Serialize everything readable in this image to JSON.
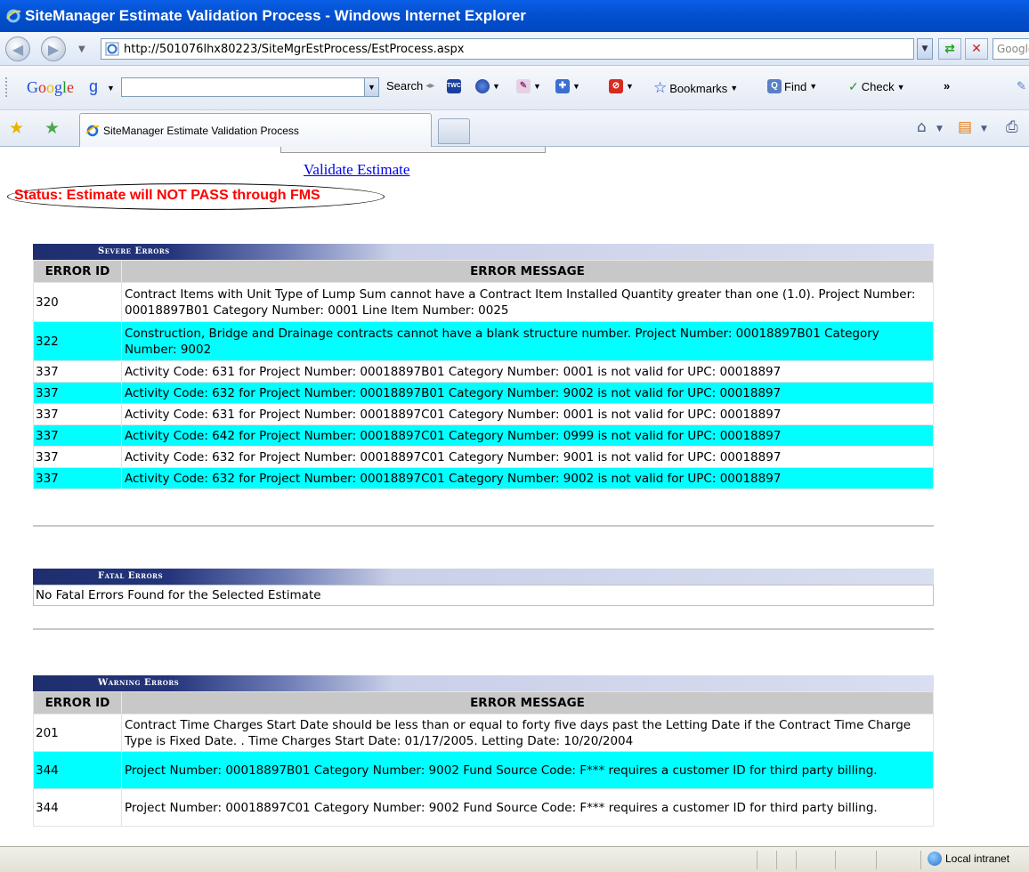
{
  "window": {
    "title": "SiteManager Estimate Validation Process - Windows Internet Explorer"
  },
  "address_bar": {
    "url": "http://501076lhx80223/SiteMgrEstProcess/EstProcess.aspx",
    "search_placeholder": "Google"
  },
  "google_toolbar": {
    "logo": [
      "G",
      "o",
      "o",
      "g",
      "l",
      "e"
    ],
    "search_label": "Search",
    "bookmarks_label": "Bookmarks",
    "find_label": "Find",
    "check_label": "Check",
    "more_label": "»"
  },
  "tabs": {
    "active_label": "SiteManager Estimate Validation Process"
  },
  "page": {
    "validate_link": "Validate Estimate",
    "status_text": "Status: Estimate will NOT PASS through FMS"
  },
  "severe": {
    "header": "Severe Errors",
    "col_id": "ERROR ID",
    "col_msg": "ERROR MESSAGE",
    "rows": [
      {
        "id": "320",
        "msg": "Contract Items with Unit Type of Lump Sum cannot have a Contract Item Installed Quantity greater than one (1.0). Project Number: 00018897B01 Category Number: 0001 Line Item Number: 0025"
      },
      {
        "id": "322",
        "msg": "Construction, Bridge and Drainage contracts cannot have a blank structure number. Project Number: 00018897B01 Category Number: 9002"
      },
      {
        "id": "337",
        "msg": "Activity Code: 631 for Project Number: 00018897B01 Category Number: 0001 is not valid for UPC: 00018897"
      },
      {
        "id": "337",
        "msg": "Activity Code: 632 for Project Number: 00018897B01 Category Number: 9002 is not valid for UPC: 00018897"
      },
      {
        "id": "337",
        "msg": "Activity Code: 631 for Project Number: 00018897C01 Category Number: 0001 is not valid for UPC: 00018897"
      },
      {
        "id": "337",
        "msg": "Activity Code: 642 for Project Number: 00018897C01 Category Number: 0999 is not valid for UPC: 00018897"
      },
      {
        "id": "337",
        "msg": "Activity Code: 632 for Project Number: 00018897C01 Category Number: 9001 is not valid for UPC: 00018897"
      },
      {
        "id": "337",
        "msg": "Activity Code: 632 for Project Number: 00018897C01 Category Number: 9002 is not valid for UPC: 00018897"
      }
    ]
  },
  "fatal": {
    "header": "Fatal Errors",
    "message": "No Fatal Errors Found for the Selected Estimate"
  },
  "warning": {
    "header": "Warning Errors",
    "col_id": "ERROR ID",
    "col_msg": "ERROR MESSAGE",
    "rows": [
      {
        "id": "201",
        "msg": "Contract Time Charges Start Date should be less than or equal to forty five days past the Letting Date if the Contract Time Charge Type is Fixed Date. . Time Charges Start Date: 01/17/2005. Letting Date: 10/20/2004"
      },
      {
        "id": "344",
        "msg": "Project Number: 00018897B01 Category Number: 9002 Fund Source Code: F*** requires a customer ID for third party billing."
      },
      {
        "id": "344",
        "msg": "Project Number: 00018897C01 Category Number: 9002 Fund Source Code: F*** requires a customer ID for third party billing."
      }
    ]
  },
  "status_bar": {
    "zone_label": "Local intranet"
  },
  "colors": {
    "alt_row": "#00ffff",
    "status_red": "#ff0000",
    "header_navy": "#1e2e6e"
  }
}
